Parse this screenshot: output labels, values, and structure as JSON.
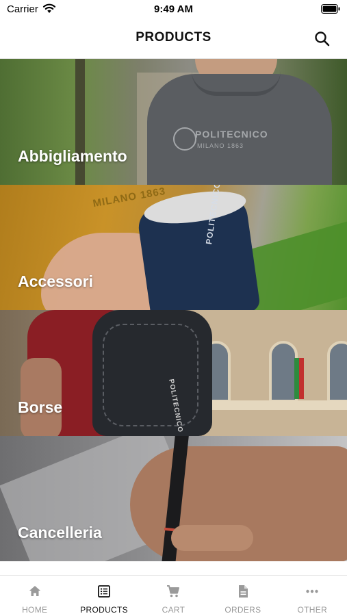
{
  "status_bar": {
    "carrier": "Carrier",
    "time": "9:49 AM"
  },
  "header": {
    "title": "PRODUCTS",
    "search_icon": "search-icon"
  },
  "categories": [
    {
      "label": "Abbigliamento",
      "image": "model-wearing-grey-sweater",
      "print_text": "POLITECNICO",
      "print_sub": "MILANO 1863"
    },
    {
      "label": "Accessori",
      "image": "hand-holding-blue-mug",
      "mug_text": "POLITECNICO MILANO 1863",
      "shirt_text": "MILANO 1863"
    },
    {
      "label": "Borse",
      "image": "student-with-backpack",
      "pack_text": "POLITECNICO"
    },
    {
      "label": "Cancelleria",
      "image": "hand-holding-pen"
    }
  ],
  "tab_bar": {
    "active_tab": "PRODUCTS",
    "tabs": [
      {
        "label": "HOME",
        "icon": "home-icon"
      },
      {
        "label": "PRODUCTS",
        "icon": "list-icon"
      },
      {
        "label": "CART",
        "icon": "cart-icon"
      },
      {
        "label": "ORDERS",
        "icon": "document-icon"
      },
      {
        "label": "OTHER",
        "icon": "more-icon"
      }
    ]
  },
  "colors": {
    "active_tab": "#111111",
    "inactive_tab": "#9a9a9a",
    "category_label": "#ffffff"
  }
}
